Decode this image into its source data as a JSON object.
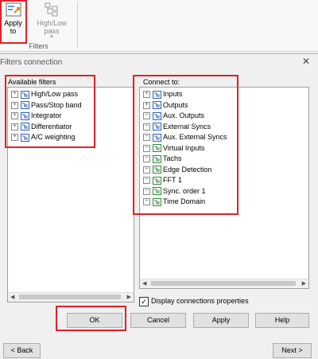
{
  "ribbon": {
    "apply_label_1": "Apply",
    "apply_label_2": "to",
    "highlow_label": "High/Low pass",
    "highlow_arrow": "▾",
    "group_label": "Filters"
  },
  "dialog": {
    "title": "Filters connection",
    "close_glyph": "✕",
    "available_label": "Available filters",
    "connect_label": "Connect to:",
    "available": [
      {
        "label": "High/Low pass",
        "expander": "+"
      },
      {
        "label": "Pass/Stop band",
        "expander": "+"
      },
      {
        "label": "Integrator",
        "expander": "+"
      },
      {
        "label": "Differentiator",
        "expander": "+"
      },
      {
        "label": "A/C weighting",
        "expander": "+"
      }
    ],
    "connect": [
      {
        "label": "Inputs",
        "expander": "+"
      },
      {
        "label": "Outputs",
        "expander": "+"
      },
      {
        "label": "Aux. Outputs",
        "expander": "−"
      },
      {
        "label": "External Syncs",
        "expander": "−"
      },
      {
        "label": "Aux. External Syncs",
        "expander": "−"
      },
      {
        "label": "Virtual Inputs",
        "expander": "−"
      },
      {
        "label": "Tachs",
        "expander": "−"
      },
      {
        "label": "Edge Detection",
        "expander": "−"
      },
      {
        "label": "FFT 1",
        "expander": "−"
      },
      {
        "label": "Sync. order 1",
        "expander": "−"
      },
      {
        "label": "Time Domain",
        "expander": "−"
      }
    ],
    "display_connections_label": "Display connections properties",
    "display_connections_checked": true,
    "check_glyph": "✓",
    "ok_label": "OK",
    "cancel_label": "Cancel",
    "apply_label": "Apply",
    "help_label": "Help",
    "back_label": "< Back",
    "next_label": "Next >"
  },
  "colors": {
    "highlight": "#e0202a",
    "folder_blue": "#2d62b5",
    "folder_green": "#2f8a3a"
  }
}
